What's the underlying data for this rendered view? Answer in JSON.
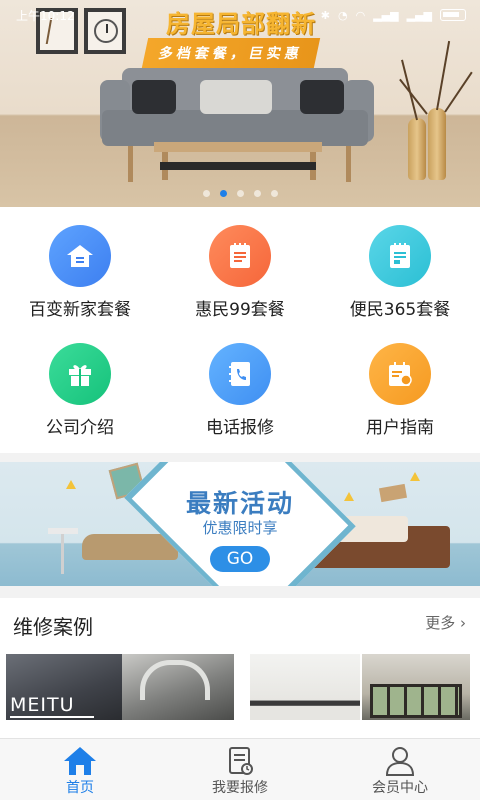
{
  "status_bar": {
    "time": "上午10:12"
  },
  "hero": {
    "title": "房屋局部翻新",
    "subtitle": "多档套餐，巨实惠",
    "slide_count": 5,
    "active_slide": 2
  },
  "menu": {
    "items": [
      {
        "label": "百变新家套餐",
        "icon": "house-icon",
        "color": "#4a8ff7"
      },
      {
        "label": "惠民99套餐",
        "icon": "receipt-icon",
        "color": "#f6714a"
      },
      {
        "label": "便民365套餐",
        "icon": "clipboard-icon",
        "color": "#3cc8dc"
      },
      {
        "label": "公司介绍",
        "icon": "gift-icon",
        "color": "#22cc85"
      },
      {
        "label": "电话报修",
        "icon": "phonebook-icon",
        "color": "#4b9bf5"
      },
      {
        "label": "用户指南",
        "icon": "calendar-icon",
        "color": "#f7a535"
      }
    ]
  },
  "promo": {
    "title": "最新活动",
    "subtitle": "优惠限时享",
    "button": "GO"
  },
  "cases": {
    "title": "维修案例",
    "more": "更多",
    "watermark": "MEITU"
  },
  "tabbar": {
    "active_color": "#1e7fe8",
    "items": [
      {
        "label": "首页",
        "icon": "home-icon",
        "active": true
      },
      {
        "label": "我要报修",
        "icon": "repair-form-icon",
        "active": false
      },
      {
        "label": "会员中心",
        "icon": "user-icon",
        "active": false
      }
    ]
  }
}
